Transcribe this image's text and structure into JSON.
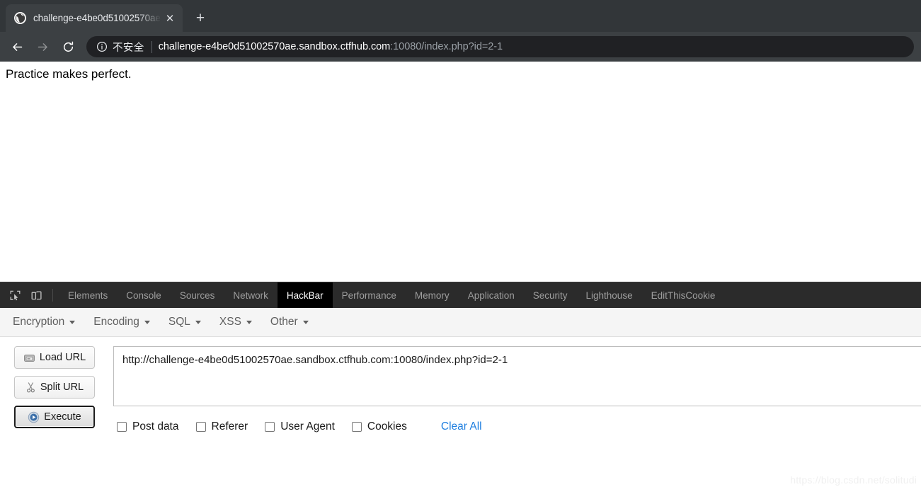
{
  "browser": {
    "tab": {
      "title": "challenge-e4be0d51002570ae.",
      "favicon_name": "globe-favicon",
      "close_label": "✕"
    },
    "new_tab_label": "+",
    "nav": {
      "back_label": "←",
      "forward_label": "→",
      "reload_label": "↻"
    },
    "omnibox": {
      "security_icon": "info-circle-icon",
      "security_text": "不安全",
      "url_host": "challenge-e4be0d51002570ae.sandbox.ctfhub.com",
      "url_rest": ":10080/index.php?id=2-1"
    }
  },
  "page": {
    "body_text": "Practice makes perfect."
  },
  "devtools": {
    "inspect_icon": "inspect-element-icon",
    "device_icon": "device-toolbar-icon",
    "tabs": [
      {
        "label": "Elements",
        "active": false
      },
      {
        "label": "Console",
        "active": false
      },
      {
        "label": "Sources",
        "active": false
      },
      {
        "label": "Network",
        "active": false
      },
      {
        "label": "HackBar",
        "active": true
      },
      {
        "label": "Performance",
        "active": false
      },
      {
        "label": "Memory",
        "active": false
      },
      {
        "label": "Application",
        "active": false
      },
      {
        "label": "Security",
        "active": false
      },
      {
        "label": "Lighthouse",
        "active": false
      },
      {
        "label": "EditThisCookie",
        "active": false
      }
    ]
  },
  "hackbar": {
    "menus": [
      {
        "label": "Encryption"
      },
      {
        "label": "Encoding"
      },
      {
        "label": "SQL"
      },
      {
        "label": "XSS"
      },
      {
        "label": "Other"
      }
    ],
    "actions": [
      {
        "label": "Load URL",
        "icon": "load-url-icon",
        "focused": false
      },
      {
        "label": "Split URL",
        "icon": "scissors-icon",
        "focused": false
      },
      {
        "label": "Execute",
        "icon": "play-icon",
        "focused": true
      }
    ],
    "url_value": "http://challenge-e4be0d51002570ae.sandbox.ctfhub.com:10080/index.php?id=2-1",
    "options": [
      {
        "label": "Post data",
        "checked": false
      },
      {
        "label": "Referer",
        "checked": false
      },
      {
        "label": "User Agent",
        "checked": false
      },
      {
        "label": "Cookies",
        "checked": false
      }
    ],
    "clear_all_label": "Clear All"
  },
  "watermark": {
    "text": "https://blog.csdn.net/solitudi"
  },
  "colors": {
    "chrome_bg": "#323639",
    "toolbar_bg": "#3c4043",
    "omnibox_bg": "#202124",
    "devtools_bg": "#2b2b2b",
    "active_tab_bg": "#000000",
    "link_blue": "#1f7fe0"
  }
}
